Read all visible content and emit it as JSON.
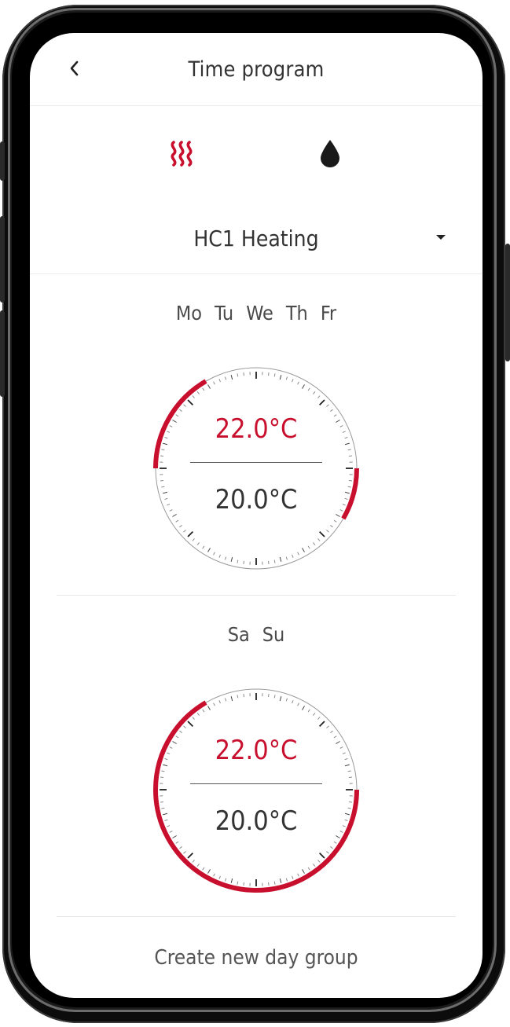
{
  "header": {
    "title": "Time program"
  },
  "icons": {
    "back": "chevron-left-icon",
    "heating_mode": "heating-waves-icon",
    "water_mode": "water-drop-icon",
    "dropdown": "caret-down-icon"
  },
  "colors": {
    "accent": "#c8102e",
    "text": "#333333",
    "divider": "#e8e8e8"
  },
  "circuit": {
    "selected": "HC1 Heating"
  },
  "day_groups": [
    {
      "days": [
        "Mo",
        "Tu",
        "We",
        "Th",
        "Fr"
      ],
      "comfort_temp": "22.0°C",
      "eco_temp": "20.0°C",
      "comfort_periods_hours": [
        [
          18,
          22
        ],
        [
          6,
          8
        ]
      ]
    },
    {
      "days": [
        "Sa",
        "Su"
      ],
      "comfort_temp": "22.0°C",
      "eco_temp": "20.0°C",
      "comfort_periods_hours": [
        [
          6,
          22
        ]
      ]
    }
  ],
  "actions": {
    "create_day_group": "Create new day group"
  }
}
